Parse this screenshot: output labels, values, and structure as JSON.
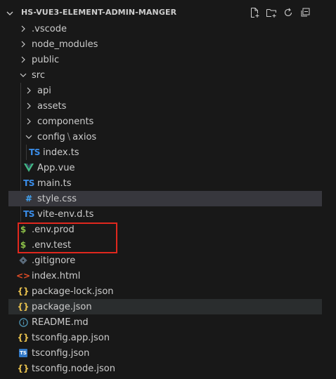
{
  "header": {
    "title": "HS-VUE3-ELEMENT-ADMIN-MANGER",
    "actions": [
      {
        "name": "new-file-icon"
      },
      {
        "name": "new-folder-icon"
      },
      {
        "name": "refresh-icon"
      },
      {
        "name": "collapse-all-icon"
      }
    ]
  },
  "tree": [
    {
      "label": ".vscode",
      "type": "folder",
      "expanded": false
    },
    {
      "label": "node_modules",
      "type": "folder",
      "expanded": false
    },
    {
      "label": "public",
      "type": "folder",
      "expanded": false
    },
    {
      "label": "src",
      "type": "folder",
      "expanded": true
    },
    {
      "label": "api",
      "type": "folder",
      "expanded": false
    },
    {
      "label": "assets",
      "type": "folder",
      "expanded": false
    },
    {
      "label": "components",
      "type": "folder",
      "expanded": false
    },
    {
      "label": "config",
      "label_suffix": "axios",
      "type": "folder",
      "expanded": true
    },
    {
      "label": "index.ts",
      "type": "ts",
      "icon_text": "TS"
    },
    {
      "label": "App.vue",
      "type": "vue"
    },
    {
      "label": "main.ts",
      "type": "ts",
      "icon_text": "TS"
    },
    {
      "label": "style.css",
      "type": "css",
      "icon_text": "#"
    },
    {
      "label": "vite-env.d.ts",
      "type": "ts",
      "icon_text": "TS"
    },
    {
      "label": ".env.prod",
      "type": "env",
      "icon_text": "$"
    },
    {
      "label": ".env.test",
      "type": "env",
      "icon_text": "$"
    },
    {
      "label": ".gitignore",
      "type": "git"
    },
    {
      "label": "index.html",
      "type": "html",
      "icon_text": "<>"
    },
    {
      "label": "package-lock.json",
      "type": "json",
      "icon_text": "{}"
    },
    {
      "label": "package.json",
      "type": "json",
      "icon_text": "{}"
    },
    {
      "label": "README.md",
      "type": "info"
    },
    {
      "label": "tsconfig.app.json",
      "type": "json",
      "icon_text": "{}"
    },
    {
      "label": "tsconfig.json",
      "type": "tsconfig",
      "icon_text": "TS"
    },
    {
      "label": "tsconfig.node.json",
      "type": "json",
      "icon_text": "{}"
    }
  ],
  "colors": {
    "background": "#181818",
    "selected_row": "#37373d",
    "highlight_box": "#e0281e",
    "ts": "#3b8eea",
    "vue": "#41b883",
    "env": "#8dc149",
    "json": "#e8c14e"
  }
}
